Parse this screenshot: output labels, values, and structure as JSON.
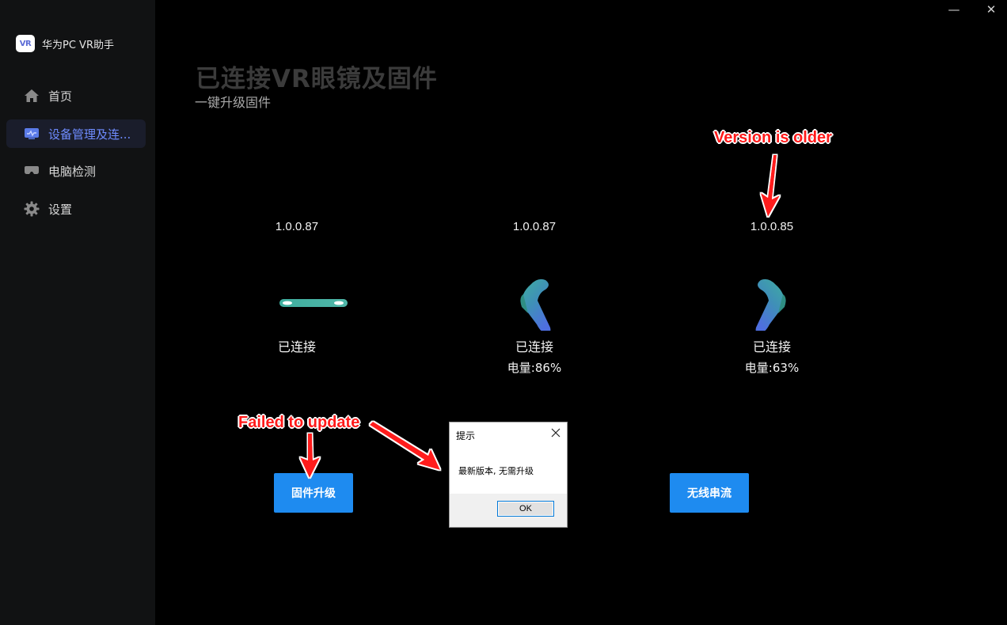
{
  "app": {
    "logo_text": "VR",
    "name": "华为PC VR助手"
  },
  "window_controls": {
    "minimize": "—",
    "close": "✕"
  },
  "sidebar": {
    "items": [
      {
        "label": "首页",
        "icon": "home-icon",
        "active": false
      },
      {
        "label": "设备管理及连...",
        "icon": "monitor-icon",
        "active": true
      },
      {
        "label": "电脑检测",
        "icon": "vr-glasses-icon",
        "active": false
      },
      {
        "label": "设置",
        "icon": "gear-icon",
        "active": false
      }
    ]
  },
  "header": {
    "title": "已连接VR眼镜及固件",
    "subtitle": "一键升级固件"
  },
  "devices": [
    {
      "type": "headset",
      "version": "1.0.0.87",
      "status": "已连接",
      "battery": ""
    },
    {
      "type": "left-controller",
      "version": "1.0.0.87",
      "status": "已连接",
      "battery": "电量:86%"
    },
    {
      "type": "right-controller",
      "version": "1.0.0.85",
      "status": "已连接",
      "battery": "电量:63%"
    }
  ],
  "buttons": {
    "firmware_upgrade": "固件升级",
    "wireless_stream": "无线串流"
  },
  "dialog": {
    "title": "提示",
    "message": "最新版本, 无需升级",
    "ok": "OK"
  },
  "annotations": {
    "version_note": "Version is older",
    "update_note": "Failed to update"
  },
  "colors": {
    "accent": "#1e8bf0",
    "active_nav": "#6f8cff",
    "sidebar_bg": "#111213",
    "annotation": "#ff1a1a"
  }
}
